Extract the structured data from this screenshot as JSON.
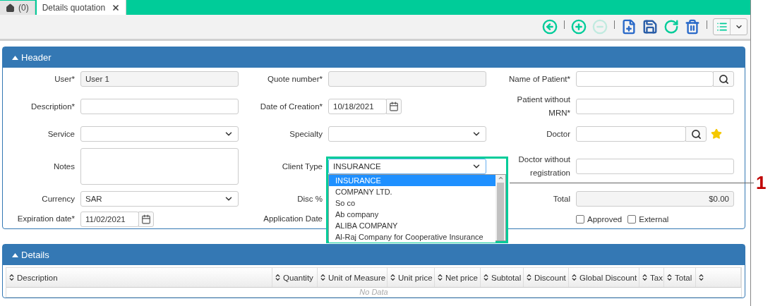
{
  "tabs": [
    {
      "kind": "home",
      "label": "(0)",
      "selected": false
    },
    {
      "kind": "page",
      "label": "Details quotation",
      "selected": true,
      "closable": true
    }
  ],
  "toolbar": {
    "buttons": [
      {
        "kind": "back",
        "disabled": false
      },
      {
        "kind": "separator"
      },
      {
        "kind": "add",
        "disabled": false
      },
      {
        "kind": "remove",
        "disabled": true
      },
      {
        "kind": "separator"
      },
      {
        "kind": "new",
        "disabled": false
      },
      {
        "kind": "save",
        "disabled": false
      },
      {
        "kind": "refresh",
        "disabled": false
      },
      {
        "kind": "delete",
        "disabled": false
      },
      {
        "kind": "separator"
      },
      {
        "kind": "view-menu",
        "disabled": false
      }
    ]
  },
  "header": {
    "title": "Header",
    "expanded": true,
    "rows": [
      [
        {
          "kind": "text",
          "label": "User*",
          "value": "User 1",
          "readonly": true
        },
        {
          "kind": "text",
          "label": "Quote number*",
          "readonly": true
        },
        {
          "kind": "search",
          "label": "Name of Patient*"
        }
      ],
      [
        {
          "kind": "text",
          "label": "Description*"
        },
        {
          "kind": "date",
          "label": "Date of Creation*",
          "value": "10/18/2021"
        },
        {
          "kind": "text",
          "label": "Patient without MRN*"
        }
      ],
      [
        {
          "kind": "select",
          "label": "Service"
        },
        {
          "kind": "select",
          "label": "Specialty"
        },
        {
          "kind": "search",
          "label": "Doctor",
          "favorite": true
        }
      ],
      [
        {
          "kind": "textarea",
          "label": "Notes"
        },
        {
          "kind": "select",
          "label": "Client Type",
          "value": "INSURANCE",
          "open": true,
          "options": [
            {
              "label": "INSURANCE",
              "selected": true
            },
            {
              "label": "COMPANY LTD.",
              "selected": false
            },
            {
              "label": "So co",
              "selected": false
            },
            {
              "label": "Ab company",
              "selected": false
            },
            {
              "label": "ALIBA COMPANY",
              "selected": false
            },
            {
              "label": "Al-Raj Company for Cooperative Insurance",
              "selected": false
            }
          ]
        },
        {
          "kind": "text",
          "label": "Doctor without registration"
        }
      ],
      [
        {
          "kind": "select",
          "label": "Currency",
          "value": "SAR"
        },
        {
          "kind": "covered",
          "label": "Disc %"
        },
        {
          "kind": "amount",
          "label": "Total",
          "value": "$0.00",
          "readonly": true
        }
      ],
      [
        {
          "kind": "date",
          "label": "Expiration date*",
          "value": "11/02/2021"
        },
        {
          "kind": "covered",
          "label": "Application Date"
        },
        {
          "kind": "checks",
          "options": [
            {
              "label": "Approved",
              "checked": false
            },
            {
              "label": "External",
              "checked": false
            }
          ]
        }
      ]
    ]
  },
  "details": {
    "title": "Details",
    "expanded": true,
    "columns": [
      {
        "kind": "sortable",
        "label": "Description"
      },
      {
        "kind": "sortable",
        "label": "Quantity"
      },
      {
        "kind": "sortable",
        "label": "Unit of Measure"
      },
      {
        "kind": "sortable",
        "label": "Unit price"
      },
      {
        "kind": "sortable",
        "label": "Net price"
      },
      {
        "kind": "sortable",
        "label": "Subtotal"
      },
      {
        "kind": "sortable",
        "label": "Discount"
      },
      {
        "kind": "sortable",
        "label": "Global Discount"
      },
      {
        "kind": "sortable",
        "label": "Tax"
      },
      {
        "kind": "sortable",
        "label": "Total"
      },
      {
        "kind": "sort-only"
      }
    ],
    "empty_text": "No Data"
  },
  "annotation": {
    "label": "1"
  }
}
